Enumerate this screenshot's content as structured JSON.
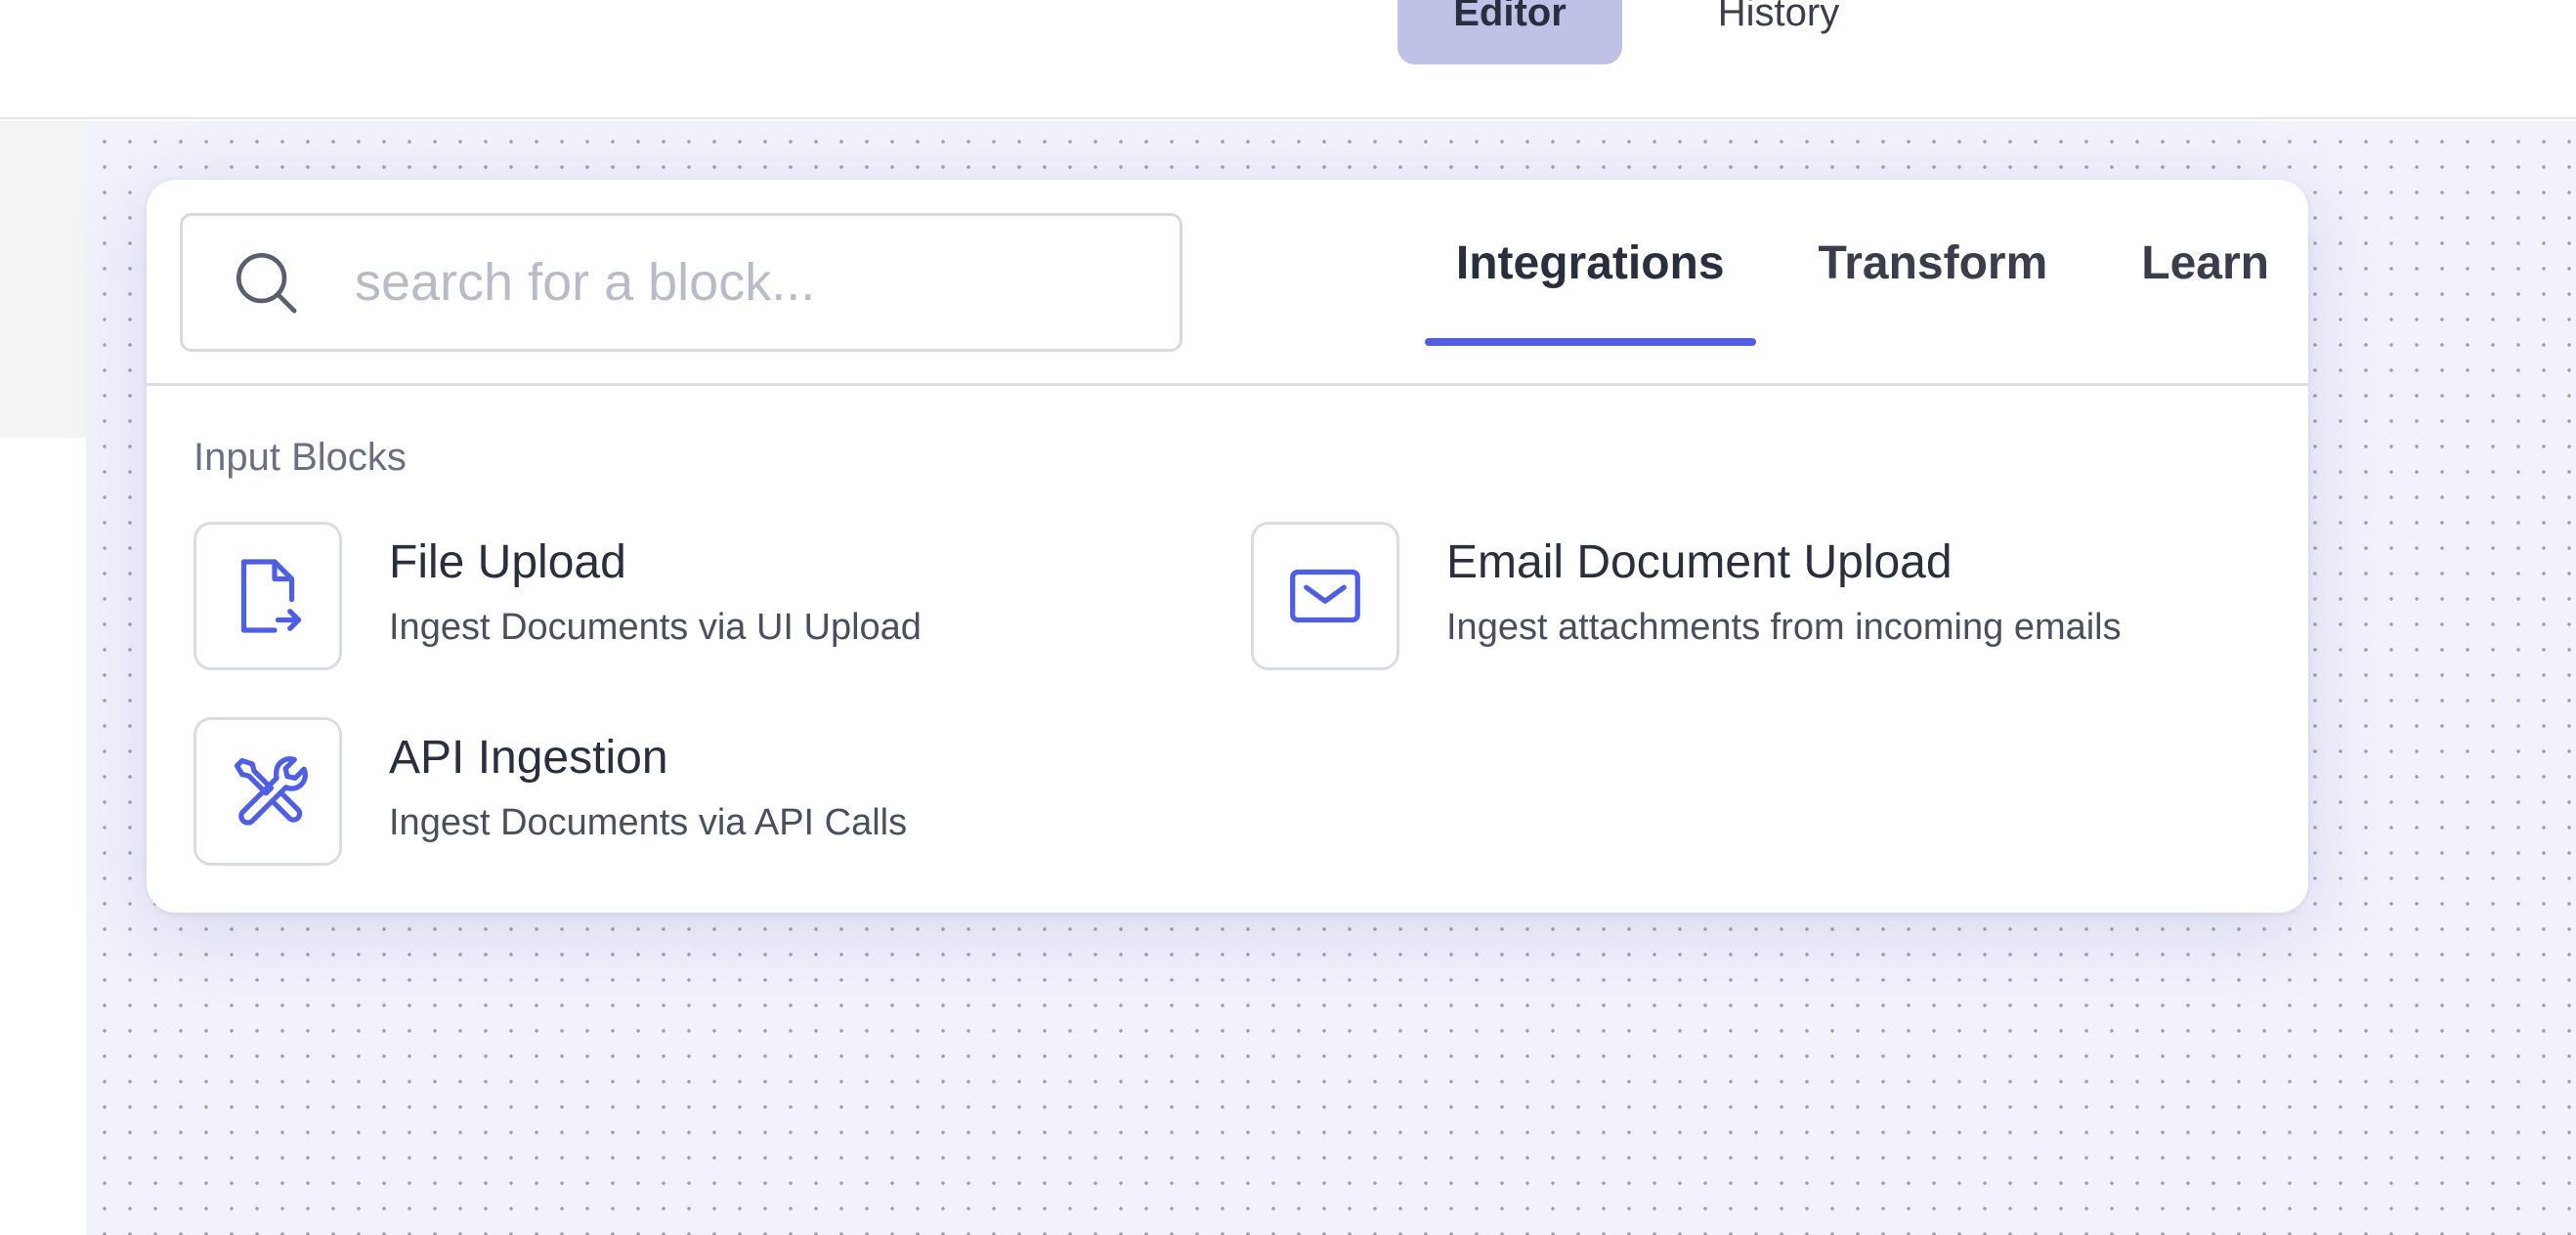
{
  "header": {
    "modes": [
      {
        "label": "Editor",
        "active": true
      },
      {
        "label": "History",
        "active": false
      }
    ]
  },
  "popover": {
    "search": {
      "value": "",
      "placeholder": "search for a block...",
      "icon": "search-icon"
    },
    "tabs": [
      {
        "label": "Integrations",
        "active": true
      },
      {
        "label": "Transform",
        "active": false
      },
      {
        "label": "Learn",
        "active": false
      }
    ],
    "section_label": "Input Blocks",
    "blocks": [
      {
        "title": "File Upload",
        "description": "Ingest Documents via UI Upload",
        "icon": "file-upload-icon"
      },
      {
        "title": "Email Document Upload",
        "description": "Ingest attachments from incoming emails",
        "icon": "envelope-icon"
      },
      {
        "title": "API Ingestion",
        "description": "Ingest Documents via API Calls",
        "icon": "tools-icon"
      }
    ]
  },
  "colors": {
    "accent": "#4f5fe3",
    "canvas_bg": "#f2f2fc",
    "editor_tab_bg": "#bfc2e6"
  }
}
